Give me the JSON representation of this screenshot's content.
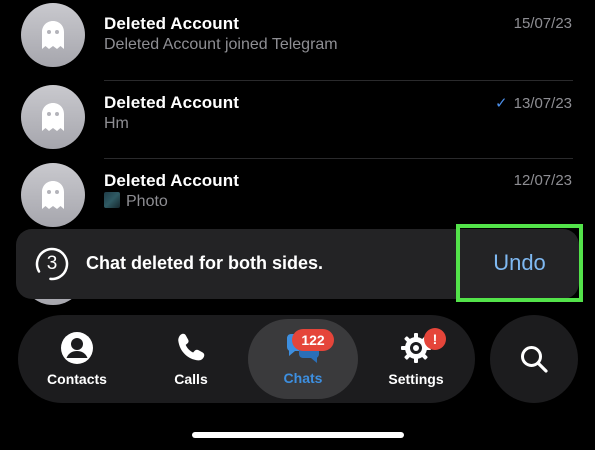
{
  "chats": [
    {
      "name": "Deleted Account",
      "preview": "Deleted Account joined Telegram",
      "date": "15/07/23",
      "read": false,
      "media": null
    },
    {
      "name": "Deleted Account",
      "preview": "Hm",
      "date": "13/07/23",
      "read": true,
      "media": null
    },
    {
      "name": "Deleted Account",
      "preview": "Photo",
      "date": "12/07/23",
      "read": false,
      "media": "photo"
    }
  ],
  "toast": {
    "countdown": "3",
    "message": "Chat deleted for both sides.",
    "undo_label": "Undo"
  },
  "tabbar": {
    "contacts_label": "Contacts",
    "calls_label": "Calls",
    "chats_label": "Chats",
    "chats_badge": "122",
    "settings_label": "Settings",
    "settings_badge": "!"
  },
  "colors": {
    "accent": "#3d8fe0",
    "badge": "#e5453a",
    "highlight_border": "#53e34a"
  }
}
